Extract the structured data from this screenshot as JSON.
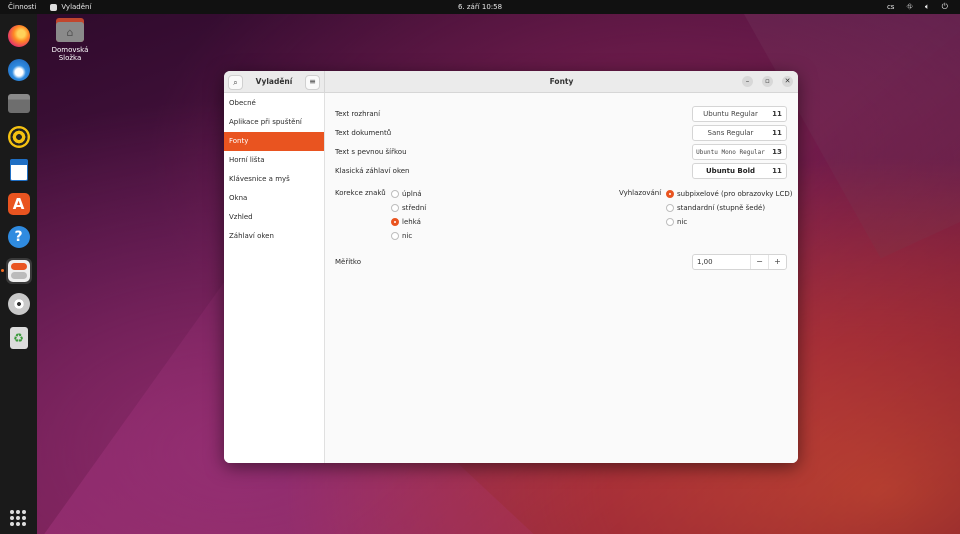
{
  "topbar": {
    "activities": "Činnosti",
    "app_name": "Vyladění",
    "clock": "6. září  10:58",
    "lang": "cs",
    "network_icon": "network-icon",
    "volume_icon": "volume-icon",
    "power_icon": "power-icon"
  },
  "dock": {
    "items": [
      "firefox-icon",
      "thunderbird-icon",
      "files-icon",
      "rhythmbox-icon",
      "writer-icon",
      "software-icon",
      "help-icon",
      "tweaks-icon",
      "disc-icon",
      "trash-icon"
    ],
    "active": "tweaks-icon"
  },
  "desktop": {
    "home_folder_label": "Domovská Složka"
  },
  "window": {
    "sidebar_title": "Vyladění",
    "title": "Fonty",
    "sidebar_items": [
      {
        "label": "Obecné",
        "selected": false
      },
      {
        "label": "Aplikace při spuštění",
        "selected": false
      },
      {
        "label": "Fonty",
        "selected": true
      },
      {
        "label": "Horní lišta",
        "selected": false
      },
      {
        "label": "Klávesnice a myš",
        "selected": false
      },
      {
        "label": "Okna",
        "selected": false
      },
      {
        "label": "Vzhled",
        "selected": false
      },
      {
        "label": "Záhlaví oken",
        "selected": false
      }
    ],
    "fonts": {
      "interface": {
        "label": "Text rozhraní",
        "font": "Ubuntu Regular",
        "size": "11"
      },
      "document": {
        "label": "Text dokumentů",
        "font": "Sans Regular",
        "size": "11"
      },
      "monospace": {
        "label": "Text s pevnou šířkou",
        "font": "Ubuntu Mono Regular",
        "size": "13"
      },
      "titlebar": {
        "label": "Klasická záhlaví oken",
        "font": "Ubuntu Bold",
        "size": "11"
      }
    },
    "hinting": {
      "label": "Korekce znaků",
      "options": [
        "úplná",
        "střední",
        "lehká",
        "nic"
      ],
      "selected": "lehká"
    },
    "antialiasing": {
      "label": "Vyhlazování",
      "options": [
        "subpixelové (pro obrazovky LCD)",
        "standardní (stupně šedé)",
        "nic"
      ],
      "selected": "subpixelové (pro obrazovky LCD)"
    },
    "scaling": {
      "label": "Měřítko",
      "value": "1,00",
      "minus": "−",
      "plus": "+"
    }
  },
  "colors": {
    "accent": "#e95420"
  }
}
